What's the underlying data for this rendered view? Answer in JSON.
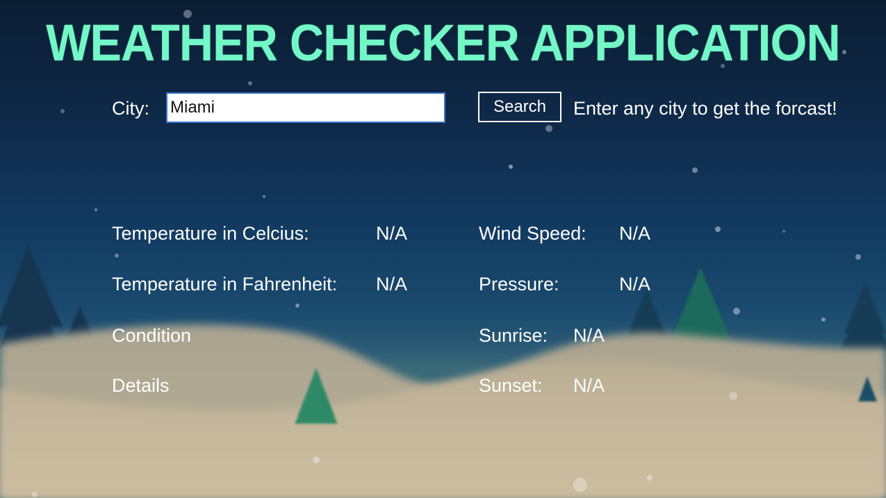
{
  "app": {
    "title": "WEATHER CHECKER APPLICATION"
  },
  "search": {
    "city_label": "City:",
    "city_value": "Miami",
    "button_label": "Search",
    "hint": "Enter any city to get the forcast!"
  },
  "weather": {
    "temp_c_label": "Temperature in Celcius:",
    "temp_c_value": "N/A",
    "temp_f_label": "Temperature in Fahrenheit:",
    "temp_f_value": "N/A",
    "condition_label": "Condition",
    "details_label": "Details",
    "wind_label": "Wind Speed:",
    "wind_value": "N/A",
    "pressure_label": "Pressure:",
    "pressure_value": "N/A",
    "sunrise_label": "Sunrise:",
    "sunrise_value": "N/A",
    "sunset_label": "Sunset:",
    "sunset_value": "N/A"
  },
  "colors": {
    "title": "#74f7c7",
    "text": "#ffffff",
    "sky_top": "#0b1d33",
    "snow_hill": "#c9b99a"
  }
}
